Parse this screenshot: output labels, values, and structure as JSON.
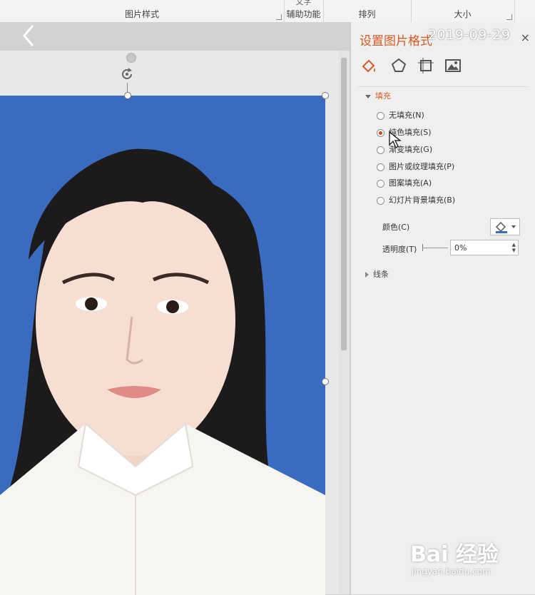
{
  "ribbon": {
    "groups": [
      {
        "label": "图片样式",
        "top": ""
      },
      {
        "label": "辅助功能",
        "top": "文字"
      },
      {
        "label": "排列",
        "top": ""
      },
      {
        "label": "大小",
        "top": ""
      }
    ]
  },
  "overlay": {
    "timestamp": "2019-09-29"
  },
  "pane": {
    "title": "设置图片格式",
    "close": "×",
    "tabs": [
      "fill-line-icon",
      "effects-icon",
      "size-properties-icon",
      "picture-icon"
    ],
    "fill_section": "填充",
    "fill_options": [
      {
        "label": "无填充(N)",
        "selected": false
      },
      {
        "label": "纯色填充(S)",
        "selected": true
      },
      {
        "label": "渐变填充(G)",
        "selected": false
      },
      {
        "label": "图片或纹理填充(P)",
        "selected": false
      },
      {
        "label": "图案填充(A)",
        "selected": false
      },
      {
        "label": "幻灯片背景填充(B)",
        "selected": false
      }
    ],
    "color_label": "颜色(C)",
    "transparency_label": "透明度(T)",
    "transparency_value": "0%",
    "line_section": "线条"
  },
  "watermark": {
    "logo": "Bai 经验",
    "url": "jingyan.baidu.com"
  },
  "colors": {
    "accent": "#d35b23",
    "photo_background": "#3a6bbf"
  }
}
